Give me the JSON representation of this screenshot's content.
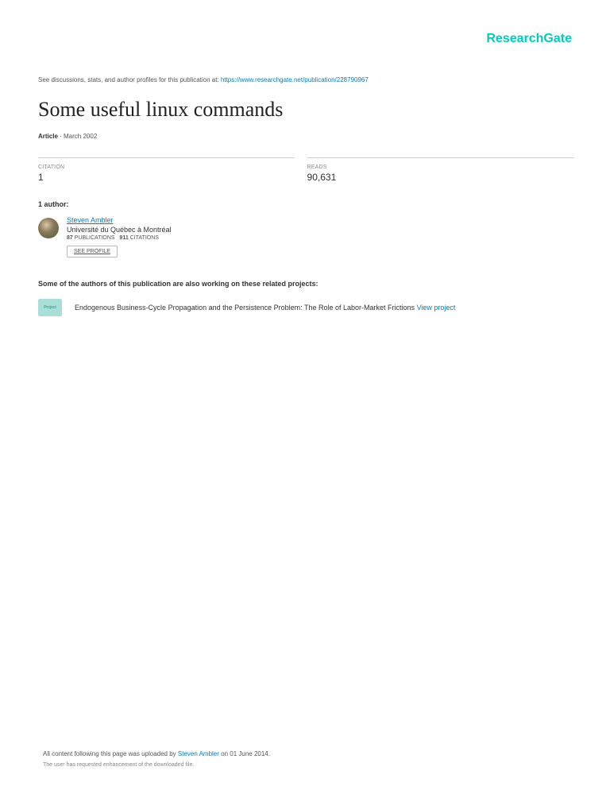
{
  "logo": "ResearchGate",
  "discussions": {
    "prefix": "See discussions, stats, and author profiles for this publication at: ",
    "url": "https://www.researchgate.net/publication/228790967"
  },
  "title": "Some useful linux commands",
  "meta": {
    "type": "Article",
    "date": "March 2002"
  },
  "stats": {
    "citation": {
      "label": "CITATION",
      "value": "1"
    },
    "reads": {
      "label": "READS",
      "value": "90,631"
    }
  },
  "authors_label": "1 author:",
  "author": {
    "name": "Steven Ambler",
    "affiliation": "Université du Québec à Montréal",
    "pubs_count": "87",
    "pubs_label": "PUBLICATIONS",
    "cits_count": "911",
    "cits_label": "CITATIONS",
    "see_profile": "SEE PROFILE"
  },
  "related_label": "Some of the authors of this publication are also working on these related projects:",
  "project": {
    "badge": "Project",
    "text": "Endogenous Business-Cycle Propagation and the Persistence Problem: The Role of Labor-Market Frictions ",
    "link": "View project"
  },
  "footer": {
    "line1_prefix": "All content following this page was uploaded by ",
    "line1_name": "Steven Ambler",
    "line1_suffix": " on 01 June 2014.",
    "line2": "The user has requested enhancement of the downloaded file."
  }
}
